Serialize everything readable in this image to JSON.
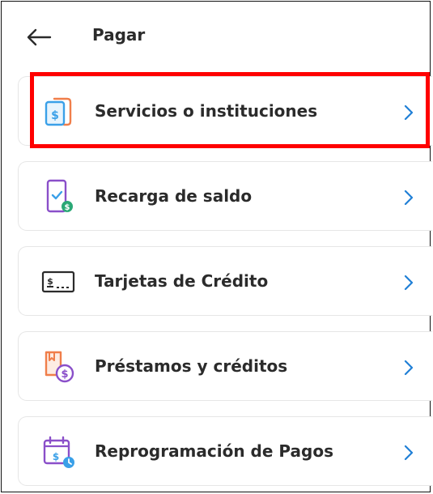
{
  "header": {
    "title": "Pagar",
    "back_icon": "arrow-left-icon"
  },
  "menu": {
    "items": [
      {
        "label": "Servicios o instituciones",
        "icon": "bill-document-icon"
      },
      {
        "label": "Recarga de saldo",
        "icon": "phone-topup-icon"
      },
      {
        "label": "Tarjetas de Crédito",
        "icon": "credit-card-icon"
      },
      {
        "label": "Préstamos y créditos",
        "icon": "loan-document-icon"
      },
      {
        "label": "Reprogramación de Pagos",
        "icon": "calendar-payment-icon"
      }
    ]
  },
  "colors": {
    "highlight": "#ff0000",
    "icon_blue": "#3aa0e8",
    "icon_orange": "#f07e4a",
    "icon_purple": "#8a4fc9",
    "icon_green": "#2aa876",
    "chevron": "#1f7fd6"
  }
}
